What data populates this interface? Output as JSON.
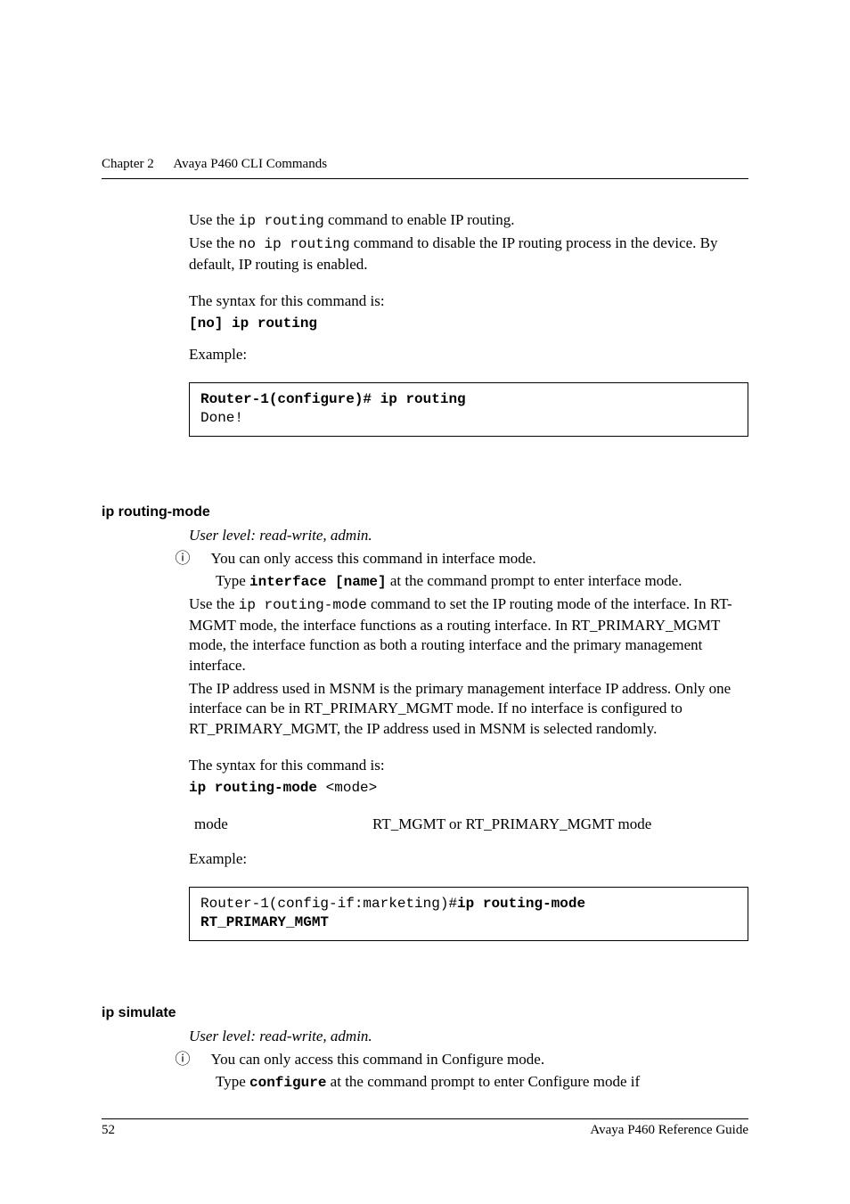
{
  "header": {
    "chapter": "Chapter 2",
    "title": "Avaya P460 CLI Commands"
  },
  "intro": {
    "p1a": "Use the ",
    "p1code": "ip routing",
    "p1b": " command to enable IP routing.",
    "p2a": "Use the ",
    "p2code": "no ip routing",
    "p2b": " command to disable the IP routing process in the device. By default, IP routing is enabled.",
    "syntax_label": "The syntax for this command is:",
    "syntax_code": "[no] ip routing",
    "example_label": "Example:",
    "example_line1": "Router-1(configure)# ip routing",
    "example_line2": "Done!"
  },
  "sec_routing_mode": {
    "heading": "ip routing-mode",
    "userlevel": "User level: read-write, admin.",
    "note1": "You can only access this command in interface mode.",
    "note2a": "Type ",
    "note2code": "interface [name]",
    "note2b": " at the command prompt to enter interface mode.",
    "p1a": "Use the ",
    "p1code": "ip routing-mode",
    "p1b": " command to set the IP routing mode of the interface. In RT-MGMT mode, the interface functions as a routing interface. In RT_PRIMARY_MGMT mode, the interface function as both a routing interface and the primary management interface.",
    "p2": "The IP address used in MSNM is the primary management interface IP address. Only one interface can be in RT_PRIMARY_MGMT mode. If no interface is configured to RT_PRIMARY_MGMT, the IP address used in MSNM is selected randomly.",
    "syntax_label": "The syntax for this command is:",
    "syntax_code_bold": "ip routing-mode",
    "syntax_code_tail": " <mode>",
    "param_name": "mode",
    "param_desc": "RT_MGMT or RT_PRIMARY_MGMT mode",
    "example_label": "Example:",
    "example_line_plain": "Router-1(config-if:marketing)#",
    "example_line_bold1": "ip routing-mode",
    "example_line_bold2": "RT_PRIMARY_MGMT"
  },
  "sec_simulate": {
    "heading": "ip simulate",
    "userlevel": "User level: read-write, admin.",
    "note1": "You can only access this command in Configure mode.",
    "note2a": "Type ",
    "note2code": "configure",
    "note2b": " at the command prompt to enter Configure mode if"
  },
  "footer": {
    "page": "52",
    "doc": "Avaya P460 Reference Guide"
  }
}
